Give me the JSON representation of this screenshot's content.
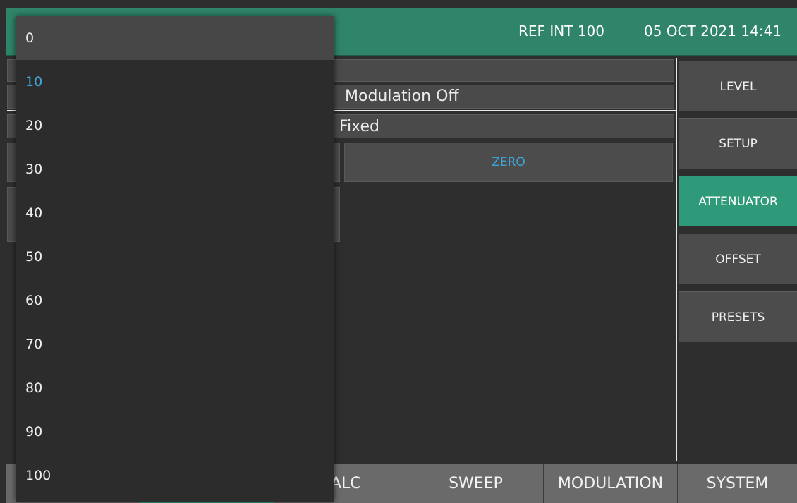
{
  "header": {
    "reference": "REF INT 100",
    "datetime": "05 OCT 2021 14:41"
  },
  "main": {
    "modulation_status": "Modulation Off",
    "attenuation_mode_partial": "n Fixed",
    "zero_button": "ZERO"
  },
  "side_menu": [
    {
      "label": "LEVEL",
      "active": false
    },
    {
      "label": "SETUP",
      "active": false
    },
    {
      "label": "ATTENUATOR",
      "active": true
    },
    {
      "label": "OFFSET",
      "active": false
    },
    {
      "label": "PRESETS",
      "active": false
    }
  ],
  "bottom_tabs": [
    {
      "label": ""
    },
    {
      "label": ""
    },
    {
      "label": "ALC"
    },
    {
      "label": "SWEEP"
    },
    {
      "label": "MODULATION"
    },
    {
      "label": "SYSTEM"
    }
  ],
  "dropdown": {
    "options": [
      "0",
      "10",
      "20",
      "30",
      "40",
      "50",
      "60",
      "70",
      "80",
      "90",
      "100"
    ],
    "highlighted": "0",
    "selected": "10"
  },
  "colors": {
    "header": "#2f8469",
    "accent_active": "#2f9a7a",
    "selected_text": "#3fa6d8"
  }
}
